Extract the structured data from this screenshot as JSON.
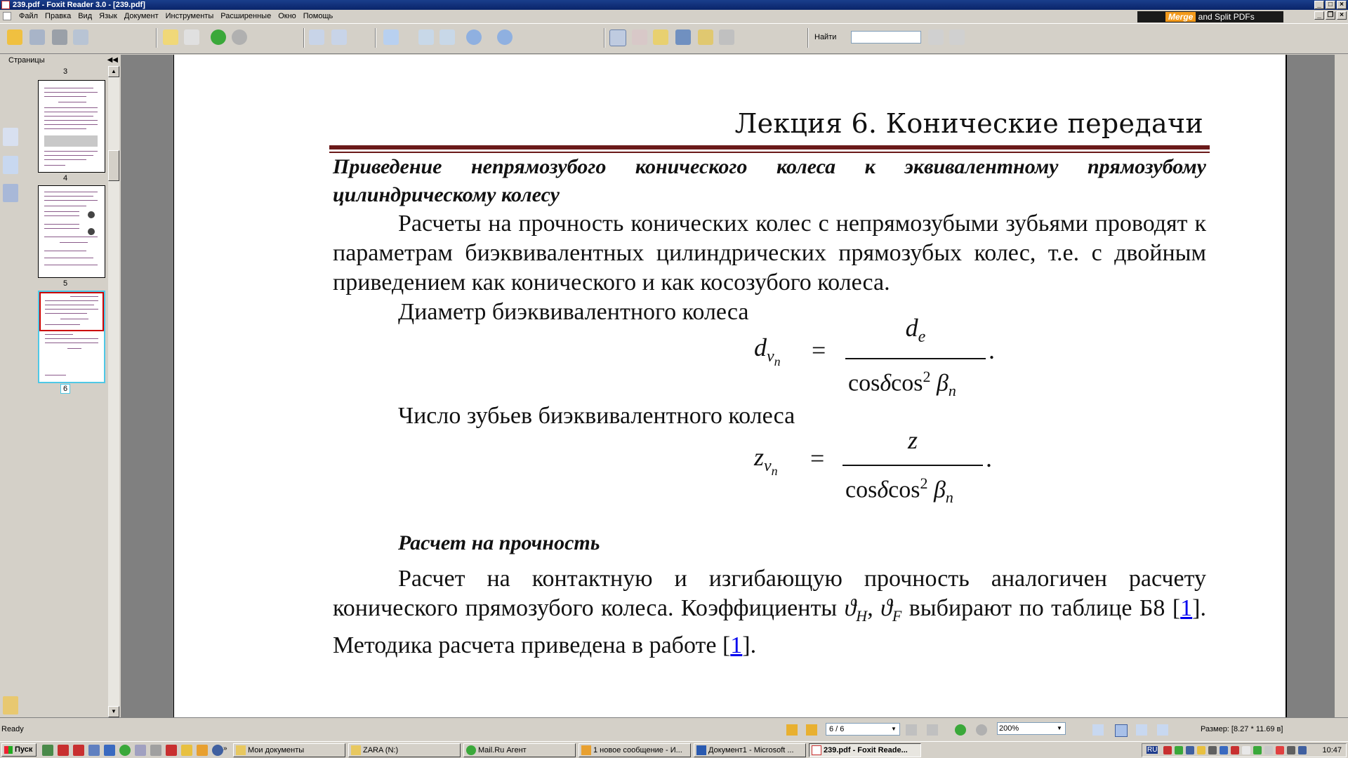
{
  "window": {
    "title": "239.pdf - Foxit Reader 3.0 - [239.pdf]"
  },
  "menu": [
    "Файл",
    "Правка",
    "Вид",
    "Язык",
    "Документ",
    "Инструменты",
    "Расширенные",
    "Окно",
    "Помощь"
  ],
  "banner": {
    "brand": "Merge",
    "rest": " and Split PDFs"
  },
  "toolbar": {
    "find_label": "Найти",
    "find_value": ""
  },
  "left_panel": {
    "title": "Страницы",
    "page_labels": [
      "3",
      "4",
      "5",
      "6"
    ],
    "current_page": "6"
  },
  "document": {
    "lecture_title": "Лекция 6. Конические передачи",
    "heading": "Приведение непрямозубого конического колеса к эквивалентному прямозубому цилиндрическому колесу",
    "para1": "Расчеты на прочность конических колес с непрямозубыми зубьями проводят к параметрам биэквивалентных цилиндрических прямозубых колес, т.е. с двойным приведением как конического и как косозубого колеса.",
    "para2": "Диаметр биэквивалентного колеса",
    "formula1": {
      "lhs_var": "d",
      "lhs_sub": "v",
      "lhs_subsub": "n",
      "num": "d",
      "num_sub": "e",
      "den_cos1": "cos",
      "den_delta": "δ",
      "den_cos2": "cos",
      "den_exp": "2",
      "den_beta": "β",
      "den_beta_sub": "n"
    },
    "para3": "Число зубьев биэквивалентного колеса",
    "formula2": {
      "lhs_var": "z",
      "lhs_sub": "v",
      "lhs_subsub": "n",
      "num": "z",
      "den_cos1": "cos",
      "den_delta": "δ",
      "den_cos2": "cos",
      "den_exp": "2",
      "den_beta": "β",
      "den_beta_sub": "n"
    },
    "subheading": "Расчет на прочность",
    "para4_part1": "Расчет на контактную и изгибающую прочность аналогичен расчету конического прямозубого колеса. Коэффициенты ",
    "coef1": "ϑ",
    "coef1_sub": "H",
    "coef2": "ϑ",
    "coef2_sub": "F",
    "para4_part2": " выбирают по таблице Б8 [",
    "ref1": "1",
    "para4_part3": "]. Методика расчета приведена в работе [",
    "ref2": "1",
    "para4_part4": "]."
  },
  "status": {
    "ready": "Ready",
    "page_field": "6 / 6",
    "zoom": "200%",
    "size": "Размер: [8.27 * 11.69 в]"
  },
  "taskbar": {
    "start": "Пуск",
    "tasks": [
      "Мои документы",
      "ZARA (N:)",
      "Mail.Ru Агент",
      "1 новое сообщение - И...",
      "Документ1 - Microsoft ...",
      "239.pdf - Foxit Reade..."
    ],
    "language": "RU",
    "clock": "10:47"
  }
}
